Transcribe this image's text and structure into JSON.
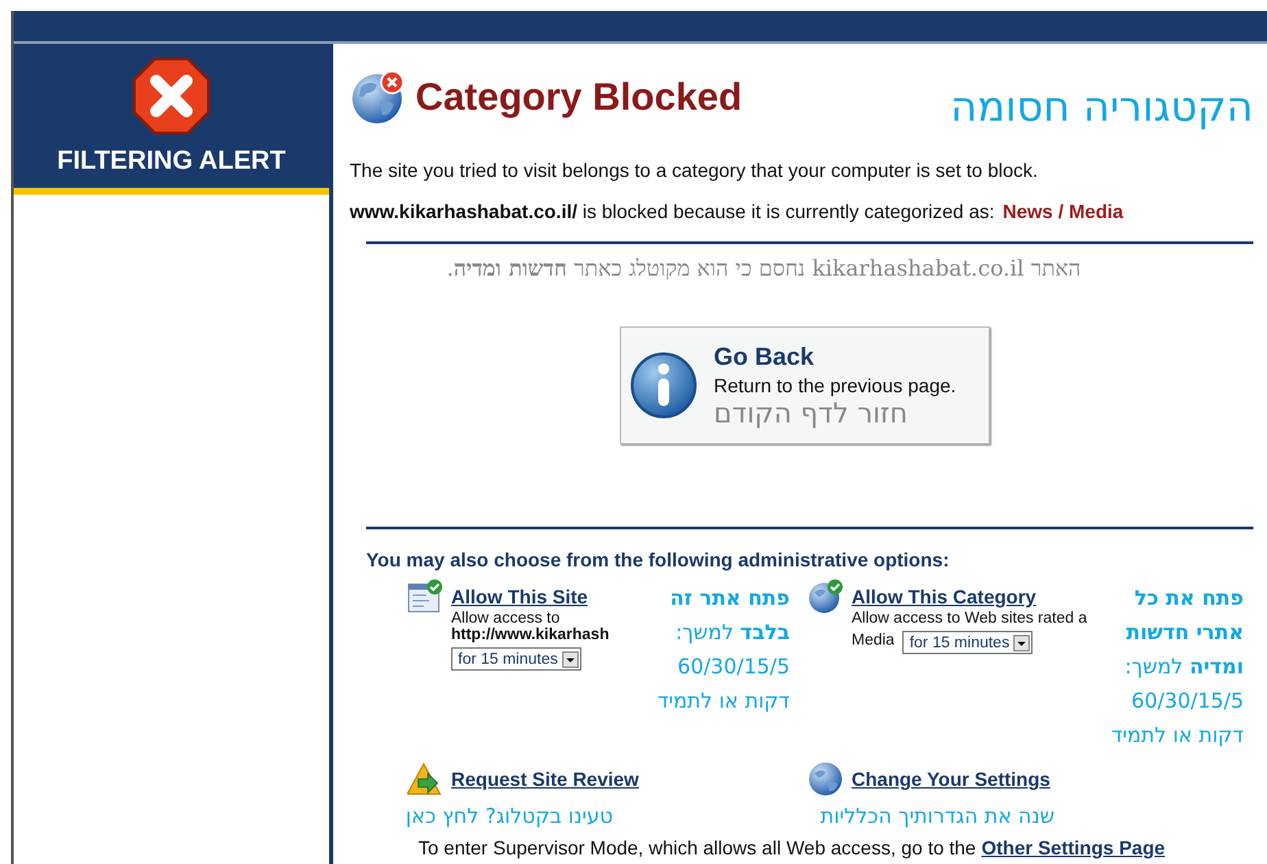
{
  "sidebar": {
    "title": "FILTERING ALERT"
  },
  "header": {
    "title": "Category Blocked",
    "annotation": "הקטגוריה חסומה"
  },
  "message": "The site you tried to visit belongs to a category that your computer is set to block.",
  "blocked_line": {
    "text": "www.kikarhashabat.co.il/ is blocked because it is currently categorized as:",
    "category": "News / Media"
  },
  "hebrew_note": "האתר kikarhashabat.co.il נחסם כי הוא מקוטלג כאתר **חדשות ומדיה**.",
  "go_back": {
    "title": "Go Back",
    "subtitle": "Return to the previous page.",
    "annotation": "חזור לדף הקודם"
  },
  "options_heading": "You may also choose from the following administrative options:",
  "option_rows": [
    {
      "left": {
        "kind": "site",
        "link": "Allow This Site",
        "description": "Allow access to",
        "detail": "http://www.kikarhash",
        "duration": "for 15 minutes",
        "note_lines": [
          "**פתח אתר זה**",
          "**בלבד** למשך:",
          "60/30/15/5",
          "דקות או לתמיד"
        ]
      },
      "right": {
        "kind": "category",
        "link": "Allow This Category",
        "description": "Allow access to Web sites rated a",
        "detail": "Media",
        "duration": "for 15 minutes",
        "note_lines": [
          "**פתח את כל**",
          "**אתרי חדשות**",
          "**ומדיה** למשך:",
          "60/30/15/5",
          "דקות או לתמיד"
        ]
      }
    },
    {
      "left": {
        "kind": "review",
        "link": "Request Site Review",
        "note_lines": [
          "טעינו בקטלוג? לחץ כאן"
        ]
      },
      "right": {
        "kind": "settings",
        "link": "Change Your Settings",
        "note_lines": [
          "שנה את הגדרותיך הכלליות"
        ]
      }
    }
  ],
  "footer": {
    "text": "To enter Supervisor Mode, which allows all Web access, go to the",
    "link": "Other Settings Page"
  }
}
